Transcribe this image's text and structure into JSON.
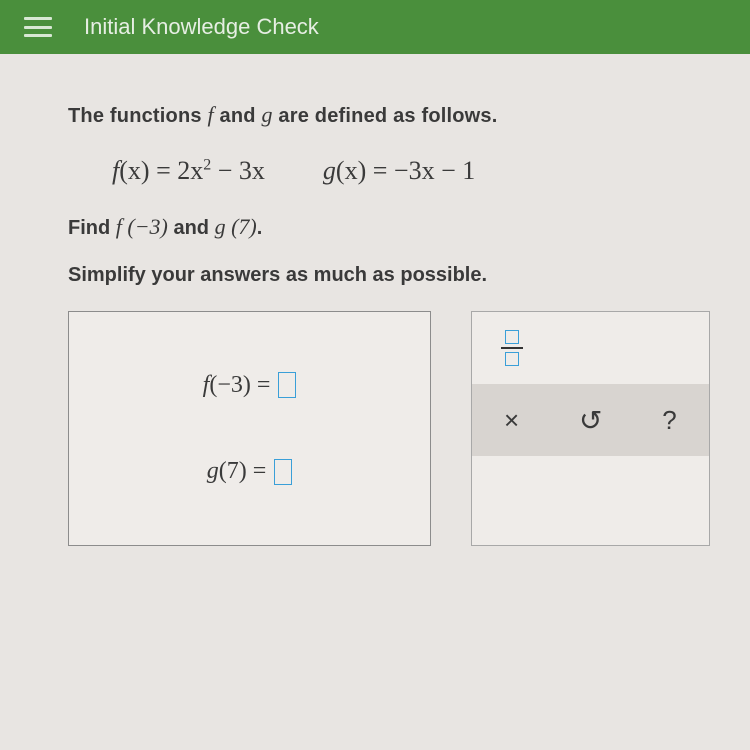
{
  "header": {
    "title": "Initial Knowledge Check"
  },
  "problem": {
    "intro_prefix": "The functions ",
    "intro_f": "f",
    "intro_and": " and ",
    "intro_g": "g",
    "intro_suffix": " are defined as follows.",
    "f_def_lhs": "f",
    "f_def_arg": "(x)",
    "f_def_eq": "=",
    "f_def_rhs_a": "2x",
    "f_def_rhs_exp": "2",
    "f_def_rhs_b": "− 3x",
    "g_def_lhs": "g",
    "g_def_arg": "(x)",
    "g_def_eq": "=",
    "g_def_rhs": "−3x − 1",
    "find_prefix": "Find ",
    "find_f": "f (−3)",
    "find_and": " and ",
    "find_g": "g (7)",
    "find_suffix": ".",
    "simplify": "Simplify your answers as much as possible."
  },
  "answers": {
    "f_label_fn": "f",
    "f_label_arg": "(−3)",
    "f_label_eq": " = ",
    "g_label_fn": "g",
    "g_label_arg": "(7)",
    "g_label_eq": " = "
  },
  "toolbox": {
    "fraction": "fraction",
    "times": "×",
    "undo": "↻",
    "help": "?"
  }
}
